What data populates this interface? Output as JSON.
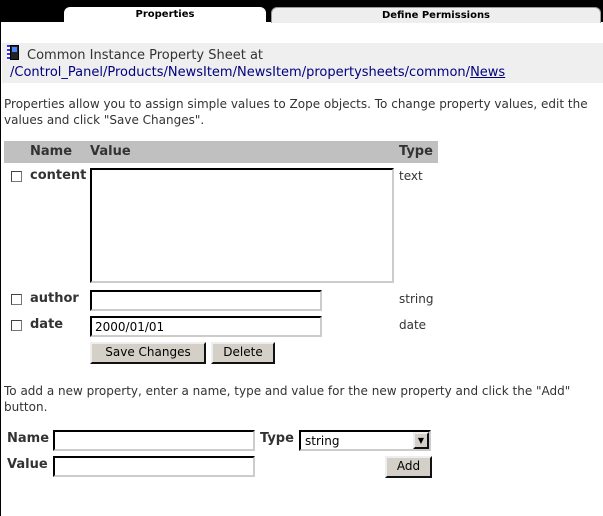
{
  "tabs": [
    {
      "label": "Properties",
      "active": true
    },
    {
      "label": "Define Permissions",
      "active": false
    }
  ],
  "header": {
    "title": "Common Instance Property Sheet at",
    "path": [
      "/",
      "Control_Panel",
      "/",
      "Products",
      "/",
      "NewsItem",
      "/",
      "NewsItem",
      "/",
      "propertysheets",
      "/",
      "common",
      "/",
      "News"
    ]
  },
  "intro": "Properties allow you to assign simple values to Zope objects. To change property values, edit the values and click \"Save Changes\".",
  "table": {
    "headers": [
      "Name",
      "Value",
      "Type"
    ],
    "rows": [
      {
        "name": "content",
        "value": "",
        "type": "text"
      },
      {
        "name": "author",
        "value": "",
        "type": "string"
      },
      {
        "name": "date",
        "value": "2000/01/01",
        "type": "date"
      }
    ]
  },
  "buttons": {
    "save": "Save Changes",
    "delete": "Delete",
    "add": "Add"
  },
  "add_intro": "To add a new property, enter a name, type and value for the new property and click the \"Add\" button.",
  "add_form": {
    "name_label": "Name",
    "type_label": "Type",
    "value_label": "Value",
    "type_selected": "string"
  }
}
